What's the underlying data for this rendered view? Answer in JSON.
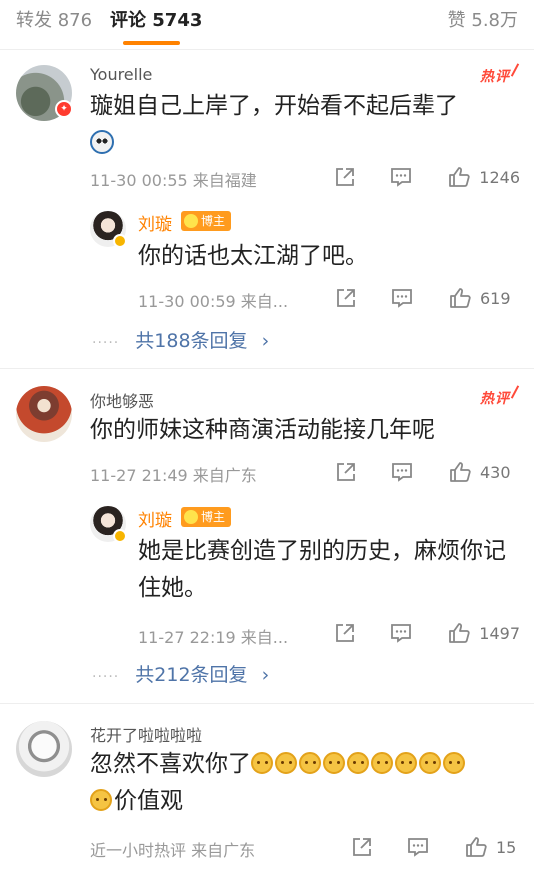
{
  "tabs": {
    "repost": "转发 876",
    "comments": "评论 5743",
    "likes": "赞 5.8万"
  },
  "hot_label": "热评",
  "comments": [
    {
      "user": "Yourelle",
      "text": "璇姐自己上岸了，开始看不起后辈了",
      "time": "11-30 00:55 来自福建",
      "likes": "1246",
      "reply": {
        "user": "刘璇",
        "badge": "博主",
        "text": "你的话也太江湖了吧。",
        "time": "11-30 00:59 来自...",
        "likes": "619"
      },
      "more": "共188条回复"
    },
    {
      "user": "你地够恶",
      "text": "你的师妹这种商演活动能接几年呢",
      "time": "11-27 21:49 来自广东",
      "likes": "430",
      "reply": {
        "user": "刘璇",
        "badge": "博主",
        "text": "她是比赛创造了别的历史，麻烦你记住她。",
        "time": "11-27 22:19 来自...",
        "likes": "1497"
      },
      "more": "共212条回复"
    },
    {
      "user": "花开了啦啦啦啦",
      "text_prefix": "忽然不喜欢你了",
      "text_suffix": "价值观",
      "time": "近一小时热评 来自广东",
      "likes": "15"
    }
  ],
  "icons": {
    "share": "share-icon",
    "comment": "comment-icon",
    "like": "thumbs-up-icon",
    "more_arrow": "chevron-right-icon",
    "emoji": "doge-emoji-icon"
  },
  "colors": {
    "accent": "#ff8200",
    "link": "#4f74a8",
    "hot": "#ff4a3a"
  }
}
